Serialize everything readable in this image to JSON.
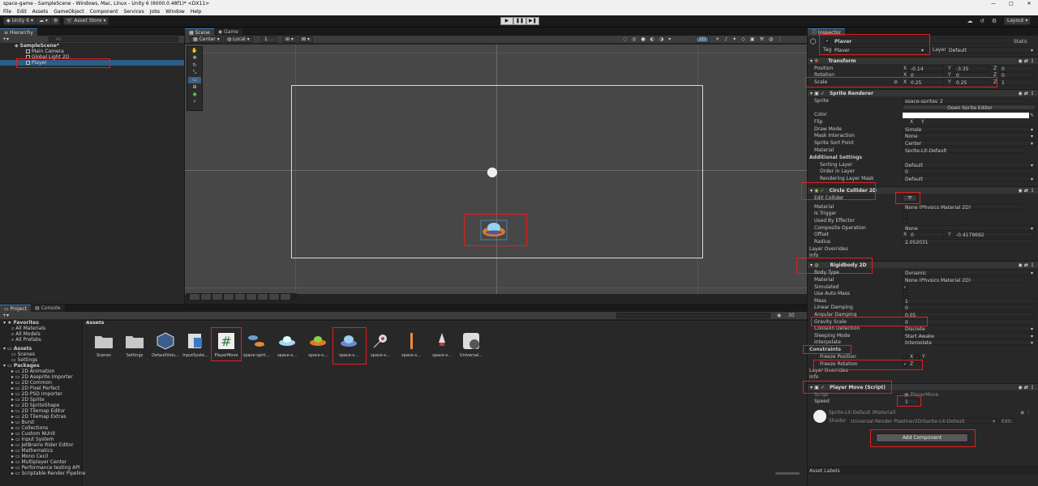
{
  "window": {
    "title": "space-game - SampleScene - Windows, Mac, Linux - Unity 6 (6000.0.48f1)* <DX11>",
    "controls": [
      "—",
      "□",
      "✕"
    ]
  },
  "menu": [
    "File",
    "Edit",
    "Assets",
    "GameObject",
    "Component",
    "Services",
    "Jobs",
    "Window",
    "Help"
  ],
  "toolbar": {
    "account": "Unity 6",
    "asset_store": "Asset Store",
    "layout": "Layout",
    "play": "▶",
    "pause": "❚❚",
    "step": "▶❚"
  },
  "hierarchy": {
    "tab": "Hierarchy",
    "search_placeholder": "All",
    "scene": "SampleScene*",
    "items": [
      "Main Camera",
      "Global Light 2D",
      "Player"
    ]
  },
  "scene_view": {
    "tabs": [
      "Scene",
      "Game"
    ],
    "pivot": "Center",
    "space": "Local",
    "grid_value": "1",
    "mode_2d": "2D"
  },
  "project": {
    "tabs": [
      "Project",
      "Console"
    ],
    "breadcrumb": "Assets",
    "item_count": "30",
    "favorites_label": "Favorites",
    "favorites": [
      "All Materials",
      "All Models",
      "All Prefabs"
    ],
    "assets_label": "Assets",
    "asset_folders": [
      "Scenes",
      "Settings"
    ],
    "packages_label": "Packages",
    "packages": [
      "2D Animation",
      "2D Aseprite Importer",
      "2D Common",
      "2D Pixel Perfect",
      "2D PSD Importer",
      "2D Sprite",
      "2D SpriteShape",
      "2D Tilemap Editor",
      "2D Tilemap Extras",
      "Burst",
      "Collections",
      "Custom NUnit",
      "Input System",
      "JetBrains Rider Editor",
      "Mathematics",
      "Mono Cecil",
      "Multiplayer Center",
      "Performance testing API",
      "Scriptable Render Pipeline"
    ],
    "assets": [
      "Scenes",
      "Settings",
      "DefaultVolu...",
      "InputSyste...",
      "PlayerMove",
      "space-sprit...",
      "space-s...",
      "space-s...",
      "space-s...",
      "space-s...",
      "space-s...",
      "space-s...",
      "Universal..."
    ]
  },
  "inspector": {
    "tab": "Inspector",
    "object_name": "Player",
    "static_label": "Static",
    "tag_label": "Tag",
    "tag": "Player",
    "layer_label": "Layer",
    "layer": "Default",
    "transform": {
      "title": "Transform",
      "position_label": "Position",
      "position": {
        "x": "-0.14",
        "y": "-3.35",
        "z": "0"
      },
      "rotation_label": "Rotation",
      "rotation": {
        "x": "0",
        "y": "0",
        "z": "0"
      },
      "scale_label": "Scale",
      "scale": {
        "x": "0.25",
        "y": "0.25",
        "z": "1"
      }
    },
    "sprite_renderer": {
      "title": "Sprite Renderer",
      "sprite_label": "Sprite",
      "sprite": "space-sprites_2",
      "open_editor": "Open Sprite Editor",
      "color_label": "Color",
      "flip_label": "Flip",
      "flip_x": "X",
      "flip_y": "Y",
      "draw_mode_label": "Draw Mode",
      "draw_mode": "Simple",
      "mask_label": "Mask Interaction",
      "mask": "None",
      "sort_point_label": "Sprite Sort Point",
      "sort_point": "Center",
      "material_label": "Material",
      "material": "Sprite-Lit-Default",
      "additional_label": "Additional Settings",
      "sorting_layer_label": "Sorting Layer",
      "sorting_layer": "Default",
      "order_label": "Order in Layer",
      "order": "0",
      "render_mask_label": "Rendering Layer Mask",
      "render_mask": "Default"
    },
    "circle_collider": {
      "title": "Circle Collider 2D",
      "edit_label": "Edit Collider",
      "material_label": "Material",
      "material": "None (Physics Material 2D)",
      "trigger_label": "Is Trigger",
      "effector_label": "Used By Effector",
      "composite_label": "Composite Operation",
      "composite": "None",
      "offset_label": "Offset",
      "offset_x": "0",
      "offset_y": "-0.4179692",
      "radius_label": "Radius",
      "radius": "2.052031",
      "layer_overrides": "Layer Overrides",
      "info": "Info"
    },
    "rigidbody": {
      "title": "Rigidbody 2D",
      "body_type_label": "Body Type",
      "body_type": "Dynamic",
      "material_label": "Material",
      "material": "None (Physics Material 2D)",
      "simulated_label": "Simulated",
      "auto_mass_label": "Use Auto Mass",
      "mass_label": "Mass",
      "mass": "1",
      "linear_label": "Linear Damping",
      "linear": "0",
      "angular_label": "Angular Damping",
      "angular": "0.05",
      "gravity_label": "Gravity Scale",
      "gravity": "0",
      "collision_label": "Collision Detection",
      "collision": "Discrete",
      "sleep_label": "Sleeping Mode",
      "sleep": "Start Awake",
      "interp_label": "Interpolate",
      "interp": "Interpolate",
      "constraints_label": "Constraints",
      "freeze_pos_label": "Freeze Position",
      "freeze_pos_x": "X",
      "freeze_pos_y": "Y",
      "freeze_rot_label": "Freeze Rotation",
      "freeze_rot_z": "Z",
      "layer_overrides": "Layer Overrides",
      "info": "Info"
    },
    "player_move": {
      "title": "Player Move (Script)",
      "script_label": "Script",
      "script": "PlayerMove",
      "speed_label": "Speed",
      "speed": "1"
    },
    "material": {
      "name": "Sprite-Lit-Default (Material)",
      "shader_label": "Shader",
      "shader": "Universal Render Pipeline/2D/Sprite-Lit-Default",
      "edit": "Edit..."
    },
    "add_component": "Add Component",
    "asset_labels": "Asset Labels"
  },
  "colors": {
    "accent": "#2c5d87",
    "highlight": "#e02020",
    "panel": "#282828",
    "header": "#353535"
  }
}
